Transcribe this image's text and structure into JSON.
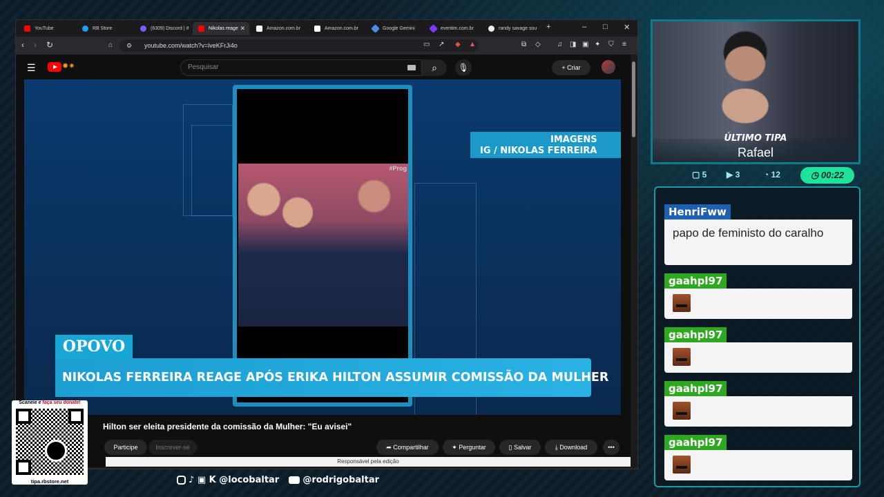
{
  "browser": {
    "tabs": [
      {
        "label": "YouTube",
        "color": "#ff0000"
      },
      {
        "label": "RB Store",
        "color": "#1da1f2"
      },
      {
        "label": "(6309) Discord | # ",
        "color": "#7b5cff"
      },
      {
        "label": "Nikolas reage",
        "color": "#ff0000"
      },
      {
        "label": "Amazon.com.br",
        "color": "#ffffff"
      },
      {
        "label": "Amazon.com.br",
        "color": "#ffffff"
      },
      {
        "label": "Google Gemini",
        "color": "#4a90e2"
      },
      {
        "label": "eventim.com.br",
        "color": "#7b3cff"
      },
      {
        "label": "randy savage sou",
        "color": "#eeeeee"
      }
    ],
    "url": "youtube.com/watch?v=lveKFrJi4o"
  },
  "youtube": {
    "search_placeholder": "Pesquisar",
    "create_label": "Criar",
    "video": {
      "credit_line1": "IMAGENS",
      "credit_line2": "IG / NIKOLAS FERREIRA",
      "brand": "OPOVO",
      "headline": "NIKOLAS FERREIRA REAGE APÓS ERIKA HILTON ASSUMIR COMISSÃO DA MULHER",
      "phone_tag": "#Prog"
    },
    "title": "Hilton ser eleita presidente da comissão da Mulher: \"Eu avisei\"",
    "actions": {
      "join": "Participe",
      "subscribe": "Inscrever-se",
      "share": "Compartilhar",
      "ask": "Perguntar",
      "save": "Salvar",
      "download": "Download"
    },
    "description": "Responsável pela edição"
  },
  "overlay": {
    "qr_caption_a": "Scaneie e ",
    "qr_caption_b": "faça seu donate!",
    "qr_url": "tipa.rbstore.net",
    "social_handle_1": "@locobaltar",
    "social_handle_2": "@rodrigobaltar",
    "last_tip_label": "ÚLTIMO TIPA",
    "last_tip_name": "Rafael",
    "stats": {
      "comments": "5",
      "videos": "3",
      "speed": "12"
    },
    "timer": "00:22"
  },
  "chat": {
    "messages": [
      {
        "user": "HenriFww",
        "text": "papo de feministo do caralho",
        "color": "#1f5fb0"
      },
      {
        "user": "gaahpl97",
        "text": "",
        "color": "#2ea820"
      },
      {
        "user": "gaahpl97",
        "text": "",
        "color": "#2ea820"
      },
      {
        "user": "gaahpl97",
        "text": "",
        "color": "#2ea820"
      },
      {
        "user": "gaahpl97",
        "text": "",
        "color": "#2ea820"
      }
    ]
  }
}
